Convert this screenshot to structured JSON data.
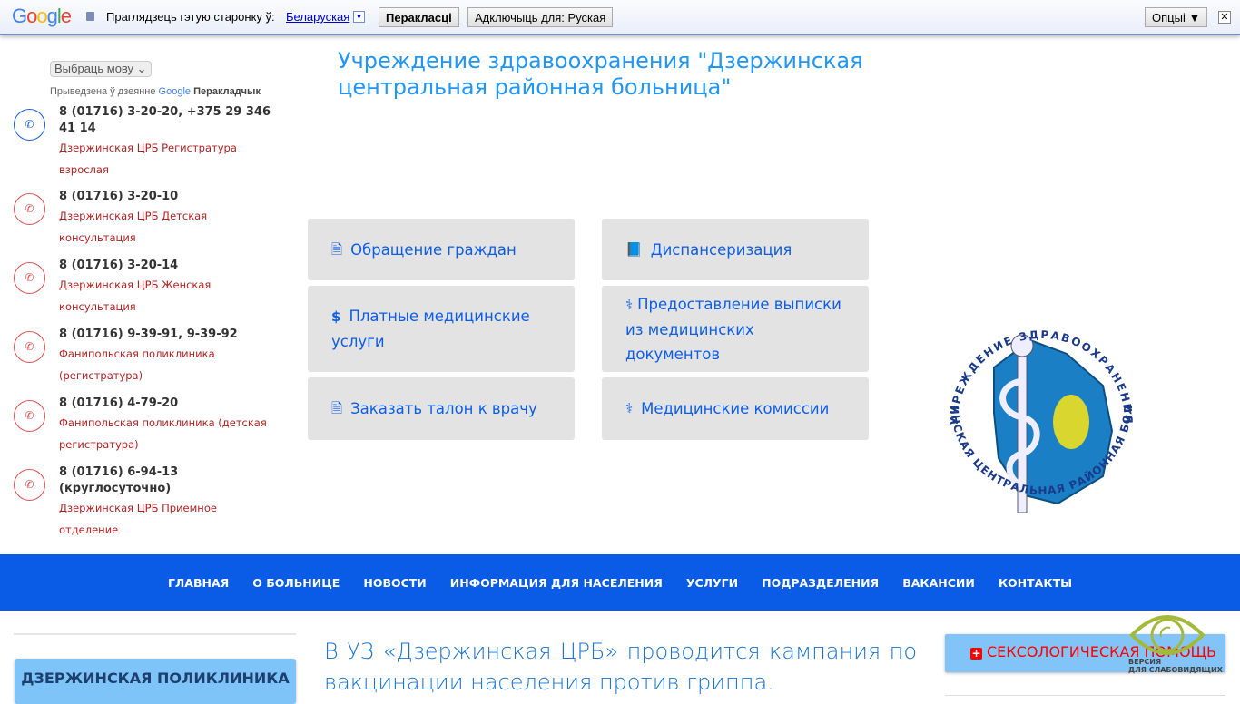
{
  "translate_bar": {
    "logo": "Google",
    "prompt": "Праглядзець гэтую старонку ў:",
    "language": "Беларуская",
    "translate_button": "Перакласці",
    "disable_button": "Адключыць для: Руская",
    "options_button": "Опцыі ▼",
    "close": "✕"
  },
  "language_select": {
    "value": "Выбраць мову"
  },
  "powered_by": {
    "prefix": "Прыведзена ў дзеянне",
    "google": "Google",
    "product": "Перакладчык"
  },
  "contacts": [
    {
      "phone": "8 (01716) 3-20-20, +375 29 346 41 14",
      "desc": "Дзержинская ЦРБ Регистратура взрослая"
    },
    {
      "phone": "8 (01716) 3-20-10",
      "desc": "Дзержинская ЦРБ Детская консультация"
    },
    {
      "phone": "8 (01716) 3-20-14",
      "desc": "Дзержинская ЦРБ Женская консультация"
    },
    {
      "phone": "8 (01716) 9-39-91, 9-39-92",
      "desc": "Фанипольская поликлиника (регистратура)"
    },
    {
      "phone": "8 (01716) 4-79-20",
      "desc": "Фанипольская поликлиника (детская регистратура)"
    },
    {
      "phone": "8 (01716) 6-94-13 (круглосуточно)",
      "desc": "Дзержинская ЦРБ Приёмное отделение"
    }
  ],
  "site_title": "Учреждение здравоохранения \"Дзержинская центральная районная больница\"",
  "tiles": [
    {
      "label": "Обращение граждан",
      "icon": "file-text-icon"
    },
    {
      "label": "Диспансеризация",
      "icon": "book-icon"
    },
    {
      "label": "Платные медицинские услуги",
      "icon": "dollar-icon"
    },
    {
      "label": "Предоставление выписки из медицинских документов",
      "icon": "user-md-icon"
    },
    {
      "label": "Заказать талон к врачу",
      "icon": "file-text-icon"
    },
    {
      "label": "Медицинские комиссии",
      "icon": "stethoscope-icon"
    }
  ],
  "logo_text": {
    "top": "УЧРЕЖДЕНИЕ ЗДРАВООХРАНЕНИЯ",
    "bottom": "ДЗЕРЖИНСКАЯ ЦЕНТРАЛЬНАЯ РАЙОННАЯ БОЛЬНИЦА"
  },
  "nav": [
    "ГЛАВНАЯ",
    "О БОЛЬНИЦЕ",
    "НОВОСТИ",
    "ИНФОРМАЦИЯ ДЛЯ НАСЕЛЕНИЯ",
    "УСЛУГИ",
    "ПОДРАЗДЕЛЕНИЯ",
    "ВАКАНСИИ",
    "КОНТАКТЫ"
  ],
  "sidebar_left": {
    "polyclinic": "ДЗЕРЖИНСКАЯ ПОЛИКЛИНИКА"
  },
  "news_headline": "В УЗ «Дзержинская ЦРБ» проводится кампания по вакцинации населения против гриппа.",
  "sidebar_right": {
    "sexology": "СЕКСОЛОГИЧЕСКАЯ ПОМОЩЬ"
  },
  "low_vision": {
    "line1": "ВЕРСИЯ",
    "line2": "ДЛЯ СЛАБОВИДЯЩИХ"
  },
  "colors": {
    "nav": "#0a5ce6",
    "tile_bg": "#e3e3e3",
    "title": "#2196f3"
  }
}
